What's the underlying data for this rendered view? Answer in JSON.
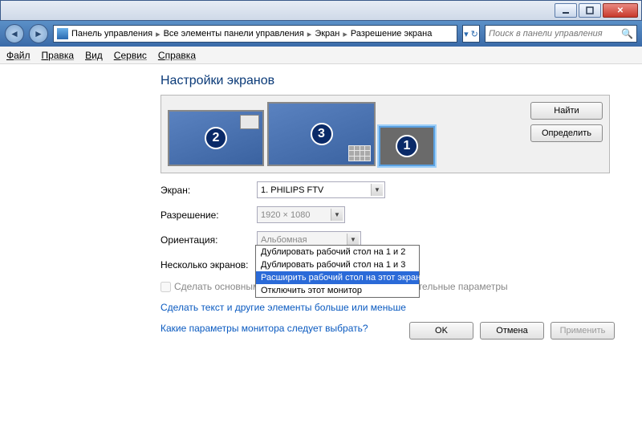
{
  "breadcrumb": {
    "items": [
      "Панель управления",
      "Все элементы панели управления",
      "Экран",
      "Разрешение экрана"
    ]
  },
  "search": {
    "placeholder": "Поиск в панели управления"
  },
  "menu": {
    "file": "Файл",
    "edit": "Правка",
    "view": "Вид",
    "service": "Сервис",
    "help": "Справка"
  },
  "title": "Настройки экранов",
  "monitors": {
    "btn_find": "Найти",
    "btn_detect": "Определить",
    "num2": "2",
    "num3": "3",
    "num1": "1"
  },
  "labels": {
    "screen": "Экран:",
    "resolution": "Разрешение:",
    "orientation": "Ориентация:",
    "multiple": "Несколько экранов:",
    "make_primary": "Сделать основным монитором",
    "advanced": "Дополнительные параметры"
  },
  "values": {
    "screen": "1. PHILIPS FTV",
    "resolution": "1920 × 1080",
    "orientation": "Альбомная",
    "multiple": "Отключить этот монитор"
  },
  "dropdown_options": {
    "dup12": "Дублировать рабочий стол на 1 и 2",
    "dup13": "Дублировать рабочий стол на 1 и 3",
    "extend": "Расширить рабочий стол на этот экран",
    "disable": "Отключить этот монитор"
  },
  "links": {
    "text_size": "Сделать текст и другие элементы больше или меньше",
    "which_monitor": "Какие параметры монитора следует выбрать?"
  },
  "buttons": {
    "ok": "OK",
    "cancel": "Отмена",
    "apply": "Применить"
  }
}
